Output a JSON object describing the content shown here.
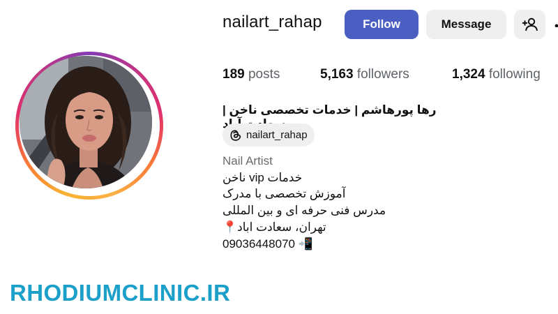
{
  "profile": {
    "username": "nailart_rahap",
    "full_name": "رها پورهاشم | خدمات تخصصی ناخن |سعادت آباد",
    "threads_handle": "nailart_rahap",
    "category": "Nail Artist",
    "bio_lines": [
      "خدمات vip ناخن",
      "آموزش تخصصی با مدرک",
      "مدرس فنی حرفه ای و بین المللی",
      "تهران، سعادت اباد📍",
      "09036448070 📲"
    ]
  },
  "actions": {
    "follow_label": "Follow",
    "message_label": "Message"
  },
  "stats": {
    "posts_count": "189",
    "posts_label": "posts",
    "followers_count": "5,163",
    "followers_label": "followers",
    "following_count": "1,324",
    "following_label": "following"
  },
  "watermark": {
    "text": "RHODIUMCLINIC.IR"
  },
  "icons": {
    "suggest": "add-person-icon",
    "threads": "threads-icon",
    "more": "more-icon"
  },
  "colors": {
    "follow_button": "#4a5fc1",
    "secondary_button": "#efefef",
    "watermark": "#1c9fc9",
    "story_ring": [
      "#f9b233",
      "#f77737",
      "#e1306c",
      "#c13584",
      "#833ab4"
    ]
  }
}
